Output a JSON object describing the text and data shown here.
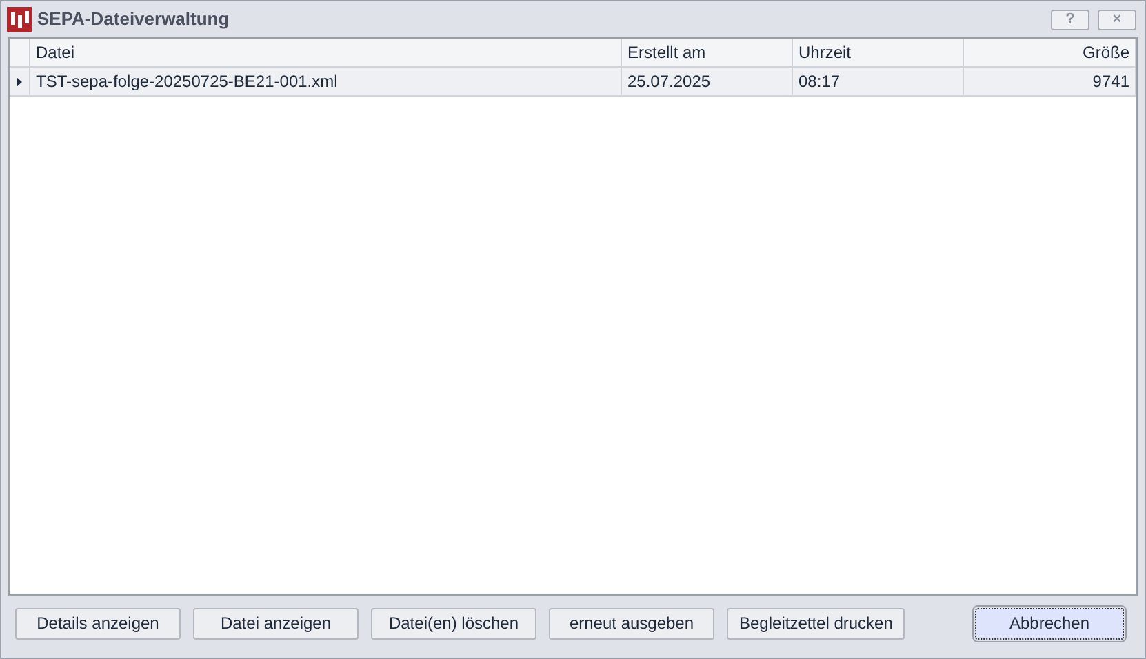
{
  "window": {
    "title": "SEPA-Dateiverwaltung",
    "buttons": [
      "?",
      "×"
    ]
  },
  "table": {
    "columns": [
      "Datei",
      "Erstellt am",
      "Uhrzeit",
      "Größe"
    ],
    "rows": [
      {
        "current": true,
        "cells": [
          "TST-sepa-folge-20250725-BE21-001.xml",
          "25.07.2025",
          "08:17",
          "9741"
        ]
      }
    ]
  },
  "buttons": [
    {
      "label": "Details anzeigen",
      "focused": false
    },
    {
      "label": "Datei anzeigen",
      "focused": false
    },
    {
      "label": "Datei(en) löschen",
      "focused": false
    },
    {
      "label": "erneut ausgeben",
      "focused": false
    },
    {
      "label": "Begleitzettel drucken",
      "focused": false
    },
    {
      "label": "Abbrechen",
      "focused": true
    }
  ]
}
